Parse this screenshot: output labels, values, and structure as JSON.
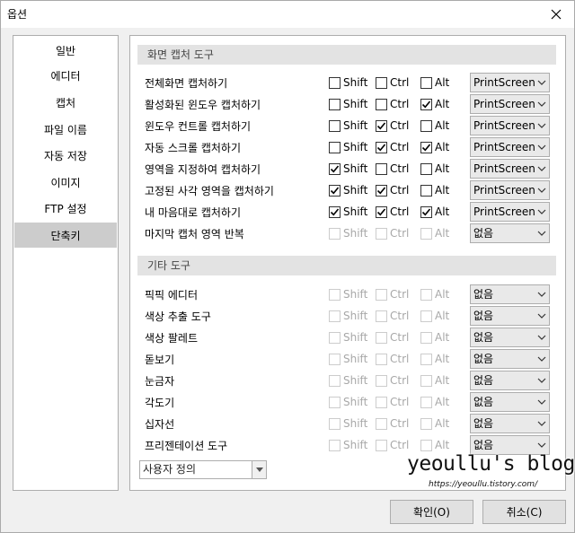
{
  "window": {
    "title": "옵션"
  },
  "sidebar": {
    "items": [
      {
        "label": "일반",
        "selected": false
      },
      {
        "label": "에디터",
        "selected": false
      },
      {
        "label": "캡처",
        "selected": false
      },
      {
        "label": "파일 이름",
        "selected": false
      },
      {
        "label": "자동 저장",
        "selected": false
      },
      {
        "label": "이미지",
        "selected": false
      },
      {
        "label": "FTP 설정",
        "selected": false
      },
      {
        "label": "단축키",
        "selected": true
      }
    ]
  },
  "modifier_labels": {
    "shift": "Shift",
    "ctrl": "Ctrl",
    "alt": "Alt"
  },
  "sections": [
    {
      "title": "화면 캡처 도구",
      "rows": [
        {
          "label": "전체화면 캡처하기",
          "shift": false,
          "ctrl": false,
          "alt": false,
          "enabled": true,
          "key": "PrintScreen"
        },
        {
          "label": "활성화된 윈도우 캡처하기",
          "shift": false,
          "ctrl": false,
          "alt": true,
          "enabled": true,
          "key": "PrintScreen"
        },
        {
          "label": "윈도우 컨트롤 캡처하기",
          "shift": false,
          "ctrl": true,
          "alt": false,
          "enabled": true,
          "key": "PrintScreen"
        },
        {
          "label": "자동 스크롤 캡처하기",
          "shift": false,
          "ctrl": true,
          "alt": true,
          "enabled": true,
          "key": "PrintScreen"
        },
        {
          "label": "영역을 지정하여 캡처하기",
          "shift": true,
          "ctrl": false,
          "alt": false,
          "enabled": true,
          "key": "PrintScreen"
        },
        {
          "label": "고정된 사각 영역을 캡처하기",
          "shift": true,
          "ctrl": true,
          "alt": false,
          "enabled": true,
          "key": "PrintScreen"
        },
        {
          "label": "내 마음대로 캡처하기",
          "shift": true,
          "ctrl": true,
          "alt": true,
          "enabled": true,
          "key": "PrintScreen"
        },
        {
          "label": "마지막 캡처 영역 반복",
          "shift": false,
          "ctrl": false,
          "alt": false,
          "enabled": false,
          "key": "없음"
        }
      ]
    },
    {
      "title": "기타 도구",
      "rows": [
        {
          "label": "픽픽 에디터",
          "shift": false,
          "ctrl": false,
          "alt": false,
          "enabled": false,
          "key": "없음"
        },
        {
          "label": "색상 추출 도구",
          "shift": false,
          "ctrl": false,
          "alt": false,
          "enabled": false,
          "key": "없음"
        },
        {
          "label": "색상 팔레트",
          "shift": false,
          "ctrl": false,
          "alt": false,
          "enabled": false,
          "key": "없음"
        },
        {
          "label": "돋보기",
          "shift": false,
          "ctrl": false,
          "alt": false,
          "enabled": false,
          "key": "없음"
        },
        {
          "label": "눈금자",
          "shift": false,
          "ctrl": false,
          "alt": false,
          "enabled": false,
          "key": "없음"
        },
        {
          "label": "각도기",
          "shift": false,
          "ctrl": false,
          "alt": false,
          "enabled": false,
          "key": "없음"
        },
        {
          "label": "십자선",
          "shift": false,
          "ctrl": false,
          "alt": false,
          "enabled": false,
          "key": "없음"
        },
        {
          "label": "프리젠테이션 도구",
          "shift": false,
          "ctrl": false,
          "alt": false,
          "enabled": false,
          "key": "없음"
        }
      ]
    }
  ],
  "preset_select": {
    "value": "사용자 정의"
  },
  "watermark": {
    "title": "yeoullu's blog",
    "url": "https://yeoullu.tistory.com/"
  },
  "buttons": {
    "ok": "확인(O)",
    "cancel": "취소(C)"
  },
  "icons": {
    "close": "close-icon",
    "chevron": "chevron-down-icon",
    "check": "check-icon"
  }
}
